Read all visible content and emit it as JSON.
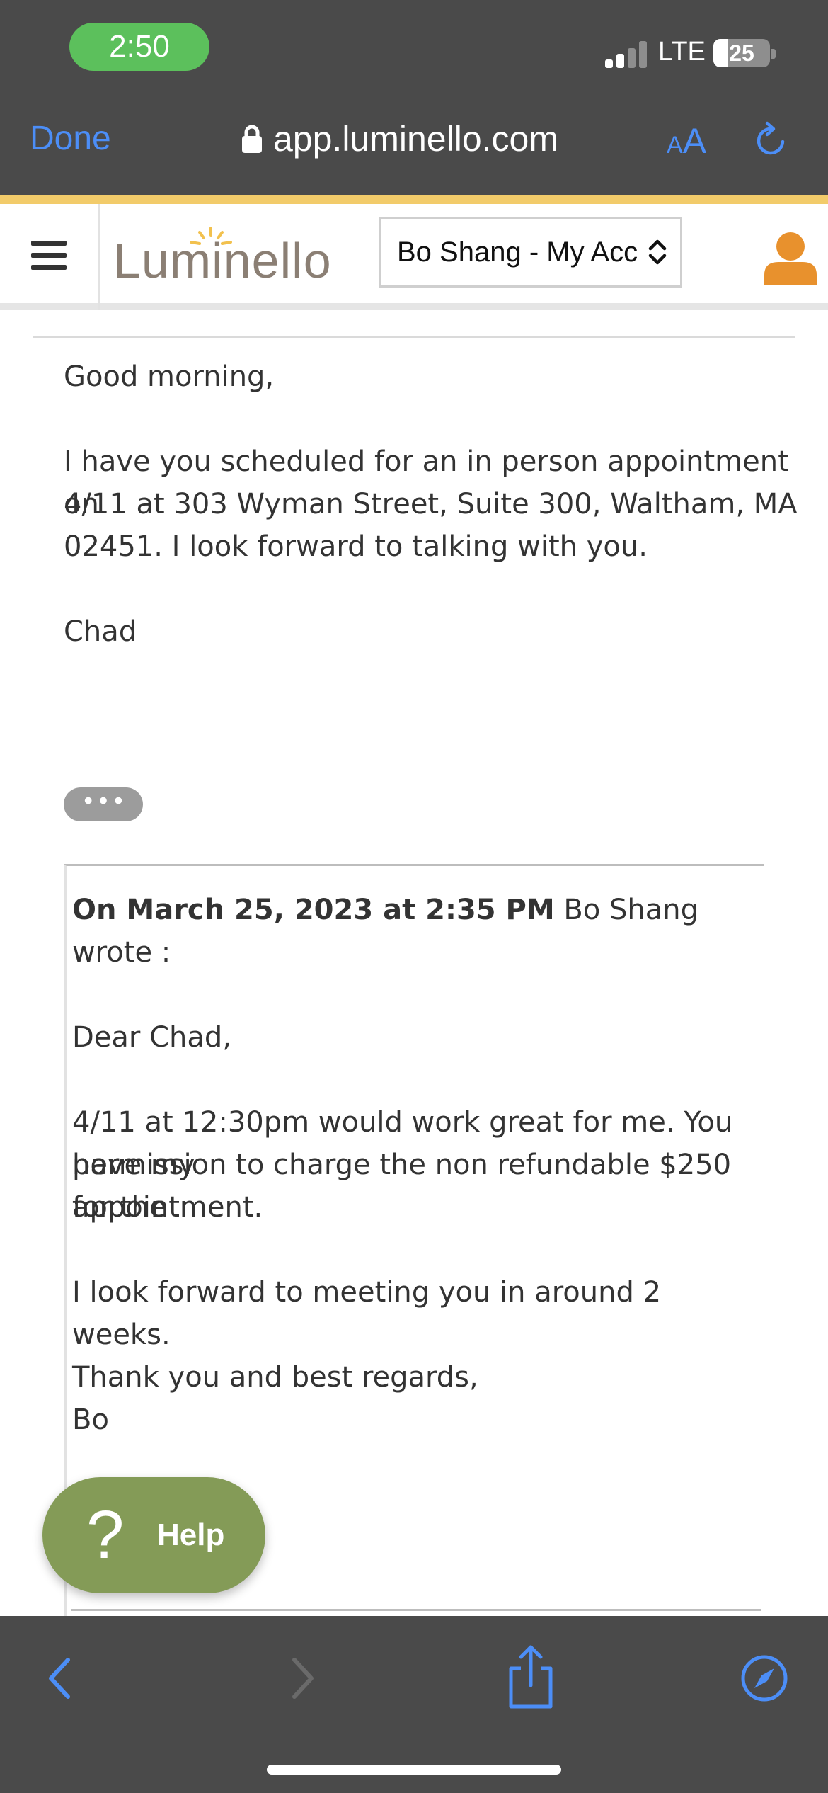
{
  "status_bar": {
    "time": "2:50",
    "network": "LTE",
    "battery": "25",
    "battery_level_percent": 25
  },
  "browser": {
    "done_label": "Done",
    "url": "app.luminello.com",
    "text_size_small": "A",
    "text_size_large": "A",
    "icons": {
      "lock": "lock-icon",
      "reload": "reload-icon",
      "back": "back-icon",
      "forward": "forward-icon",
      "share": "share-icon",
      "compass": "compass-icon"
    },
    "accent_color": "#4c8ef7"
  },
  "app": {
    "logo_text": "Luminello",
    "account_select_value": "Bo Shang - My Acco",
    "brand_gold": "#f2cb6a",
    "user_icon_color": "#e8912d",
    "help_label": "Help",
    "help_color": "#849b57"
  },
  "message": {
    "greeting": "Good morning,",
    "body_lines": [
      "I have you scheduled for an in person appointment on",
      "4/11 at  303 Wyman Street, Suite 300, Waltham, MA",
      "02451. I look forward to talking with you."
    ],
    "signature": "Chad",
    "expand_label": "• • •"
  },
  "quoted": {
    "header_bold": "On March 25, 2023 at 2:35 PM",
    "header_rest": " Bo Shang wrote :",
    "salutation": "Dear Chad,",
    "para1_lines": [
      "4/11 at 12:30pm would work great for me. You have my",
      "permission to charge the non refundable $250 for the",
      "appointment."
    ],
    "para2": "I look forward to meeting you in around 2 weeks.",
    "closing": "Thank you and best regards,",
    "name": "Bo"
  }
}
